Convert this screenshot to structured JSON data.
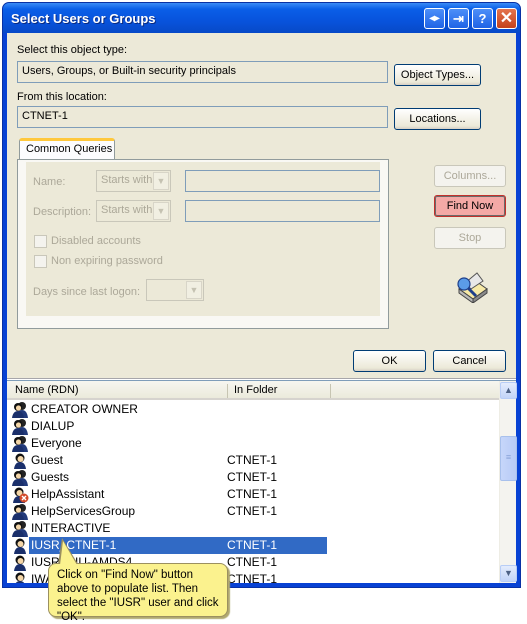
{
  "window": {
    "title": "Select Users or Groups",
    "titlebar_buttons": [
      {
        "name": "switch-icon",
        "glyph": "◂▸"
      },
      {
        "name": "exit-icon",
        "glyph": "⇥"
      },
      {
        "name": "help-icon",
        "glyph": "?"
      },
      {
        "name": "close-icon",
        "glyph": "✕"
      }
    ]
  },
  "object_type": {
    "label": "Select this object type:",
    "value": "Users, Groups, or Built-in security principals",
    "button": "Object Types..."
  },
  "location": {
    "label": "From this location:",
    "value": "CTNET-1",
    "button": "Locations..."
  },
  "query": {
    "tab_label": "Common Queries",
    "name_label": "Name:",
    "name_operator": "Starts with",
    "name_value": "",
    "description_label": "Description:",
    "description_operator": "Starts with",
    "description_value": "",
    "disabled_accounts_label": "Disabled accounts",
    "disabled_accounts_checked": false,
    "non_expiring_label": "Non expiring password",
    "non_expiring_checked": false,
    "days_label": "Days since last logon:",
    "days_value": ""
  },
  "side_buttons": {
    "columns": "Columns...",
    "find_now": "Find Now",
    "stop": "Stop"
  },
  "dialog_buttons": {
    "ok": "OK",
    "cancel": "Cancel"
  },
  "results": {
    "columns": [
      "Name (RDN)",
      "In Folder"
    ],
    "rows": [
      {
        "name": "CREATOR OWNER",
        "folder": "",
        "icon": "group-icon",
        "selected": false
      },
      {
        "name": "DIALUP",
        "folder": "",
        "icon": "group-icon",
        "selected": false
      },
      {
        "name": "Everyone",
        "folder": "",
        "icon": "group-icon",
        "selected": false
      },
      {
        "name": "Guest",
        "folder": "CTNET-1",
        "icon": "user-icon",
        "selected": false
      },
      {
        "name": "Guests",
        "folder": "CTNET-1",
        "icon": "group-icon",
        "selected": false
      },
      {
        "name": "HelpAssistant",
        "folder": "CTNET-1",
        "icon": "disabled-user-icon",
        "selected": false
      },
      {
        "name": "HelpServicesGroup",
        "folder": "CTNET-1",
        "icon": "group-icon",
        "selected": false
      },
      {
        "name": "INTERACTIVE",
        "folder": "",
        "icon": "group-icon",
        "selected": false
      },
      {
        "name": "IUSR_CTNET-1",
        "folder": "CTNET-1",
        "icon": "user-icon",
        "selected": true
      },
      {
        "name": "IUSR_NIU-AMDS4",
        "folder": "CTNET-1",
        "icon": "user-icon",
        "selected": false
      },
      {
        "name": "IWAM",
        "folder": "CTNET-1",
        "icon": "user-icon",
        "selected": false
      }
    ]
  },
  "callout": {
    "text": "Click on \"Find Now\" button above to populate list.  Then select the \"IUSR\" user and click \"OK\"."
  }
}
